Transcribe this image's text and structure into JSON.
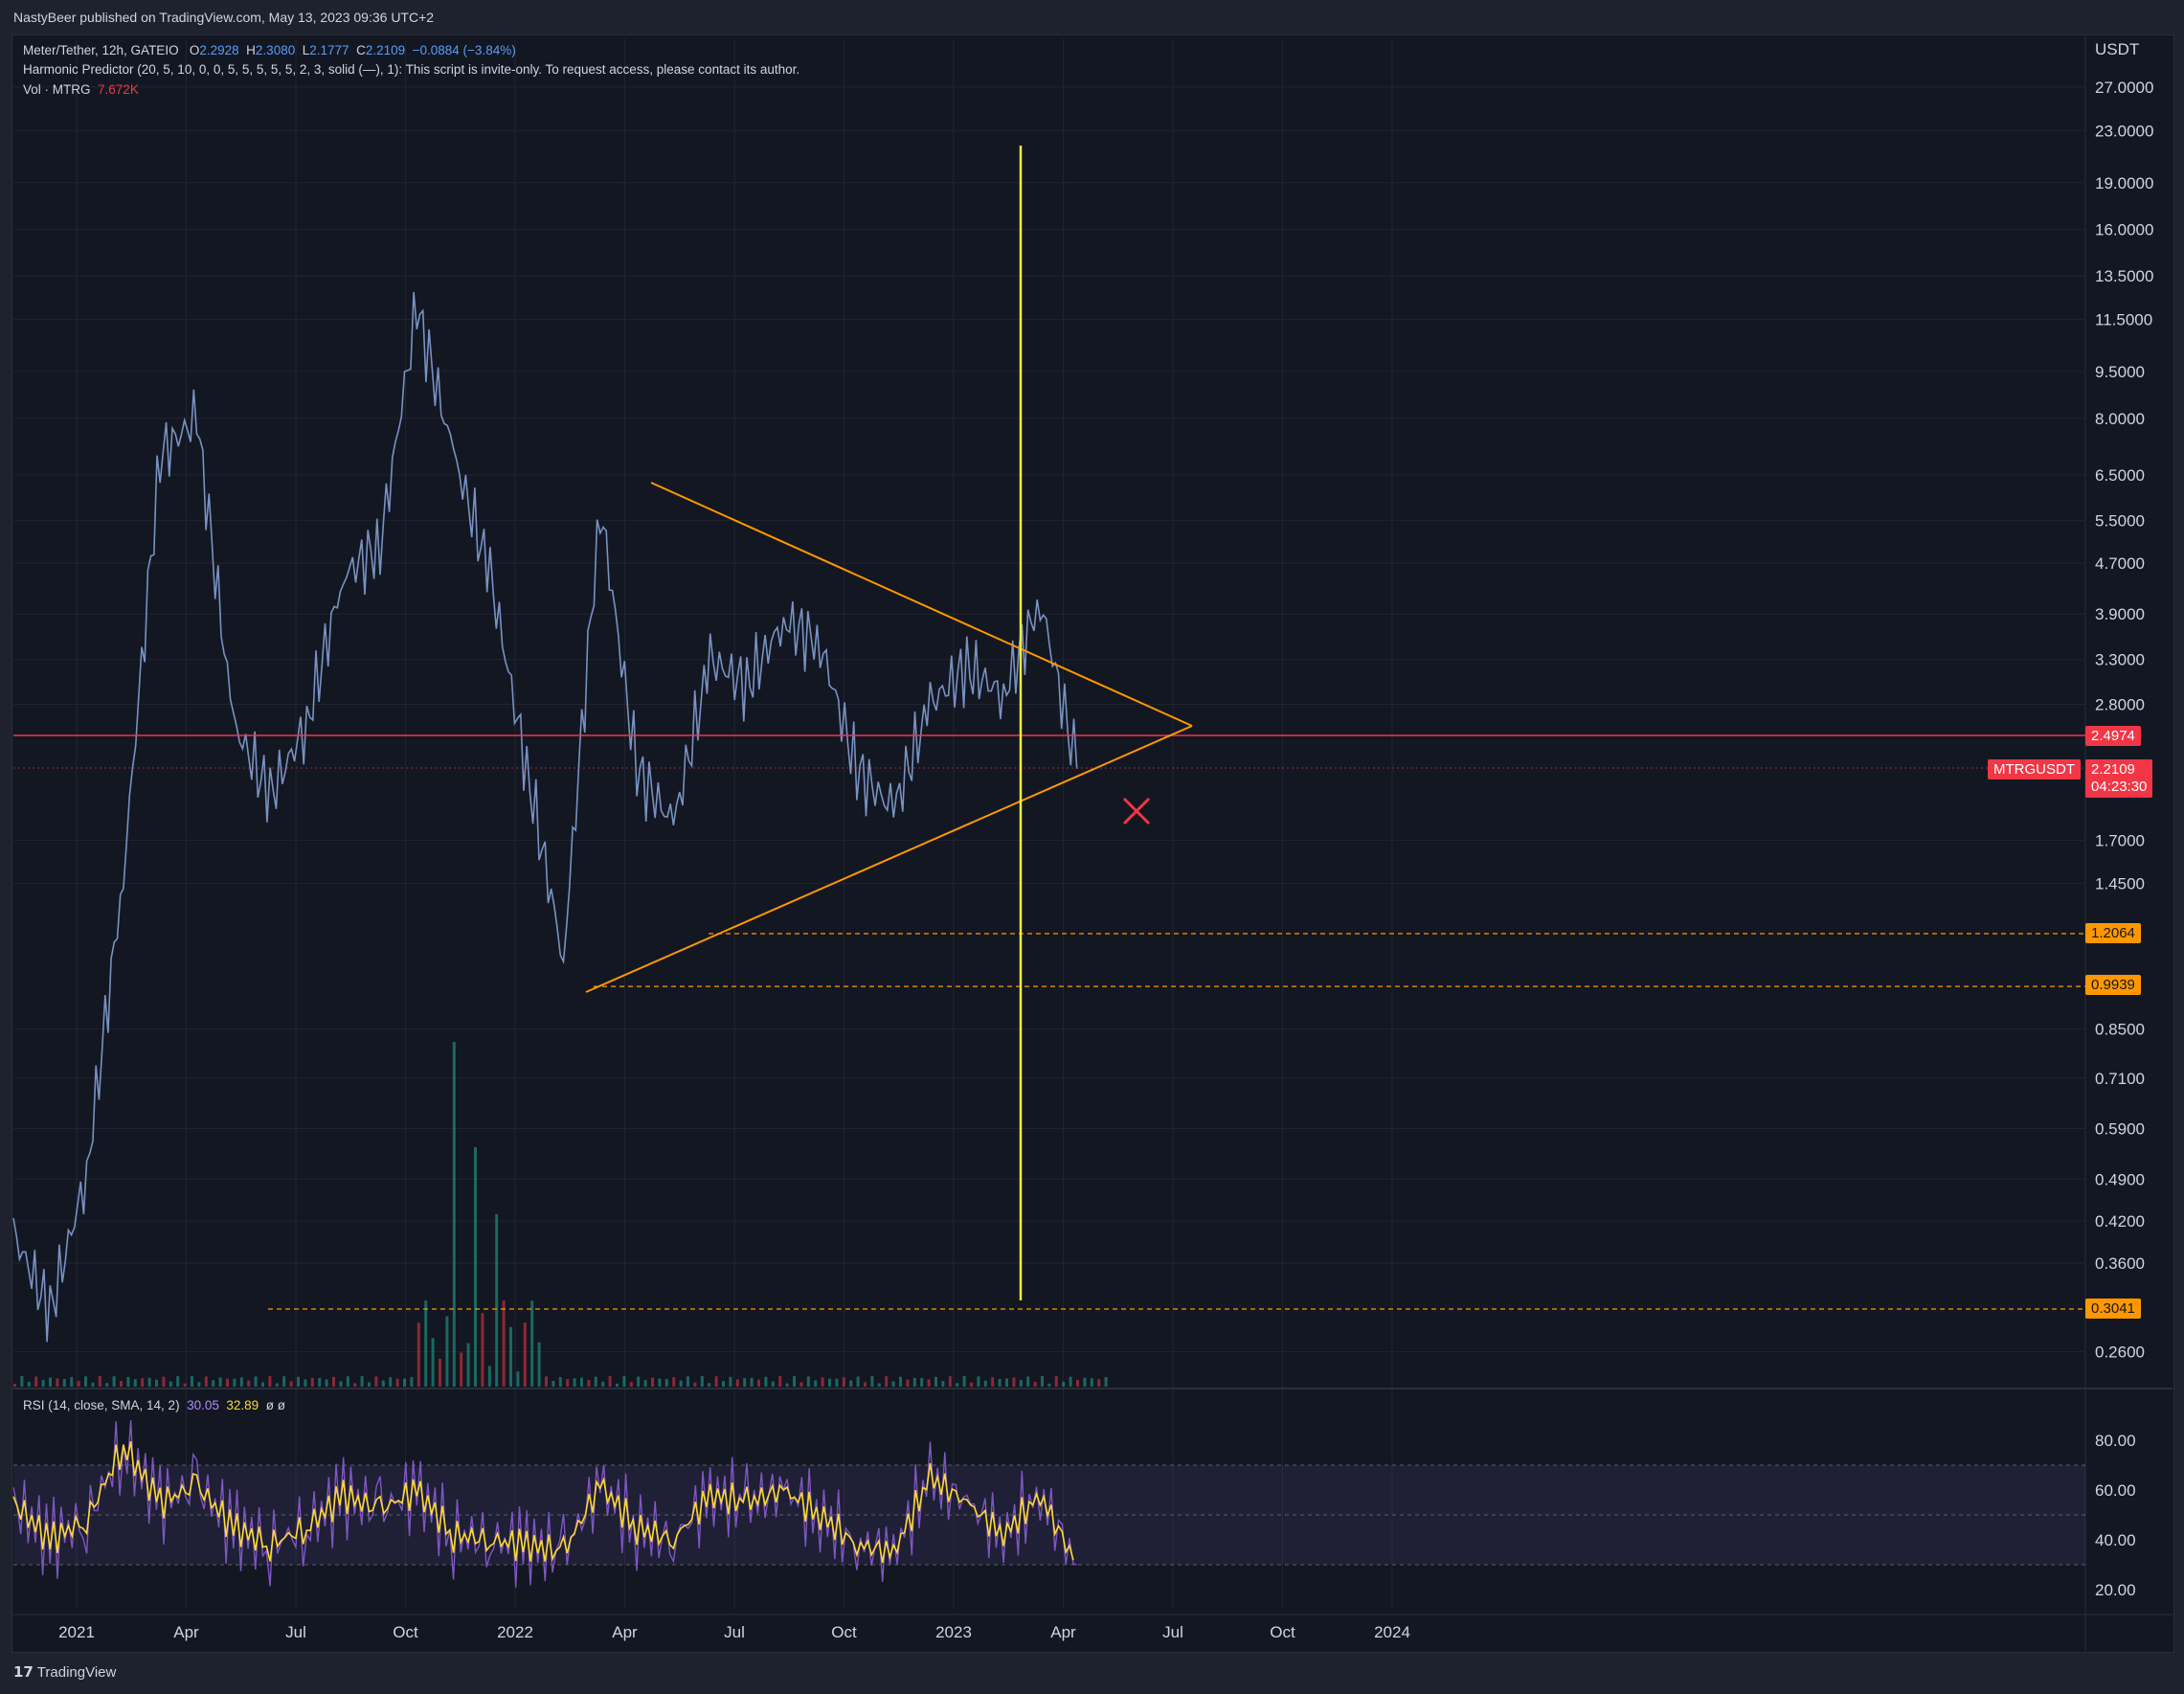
{
  "header": {
    "published": "NastyBeer published on TradingView.com, May 13, 2023 09:36 UTC+2"
  },
  "legend": {
    "symbol": "Meter/Tether, 12h, GATEIO",
    "o_label": "O",
    "o": "2.2928",
    "h_label": "H",
    "h": "2.3080",
    "l_label": "L",
    "l": "2.1777",
    "c_label": "C",
    "c": "2.2109",
    "change": "−0.0884 (−3.84%)",
    "indicator": "Harmonic Predictor (20, 5, 10, 0, 0, 5, 5, 5, 5, 5, 2, 3, solid (—), 1): This script is invite-only. To request access, please contact its author.",
    "vol_label": "Vol · MTRG",
    "vol_value": "7.672K",
    "rsi_label": "RSI (14, close, SMA, 14, 2)",
    "rsi_value": "30.05",
    "rsi_ma": "32.89",
    "rsi_extra": "ø  ø"
  },
  "price_axis": {
    "currency": "USDT",
    "labels": [
      "27.0000",
      "23.0000",
      "19.0000",
      "16.0000",
      "13.5000",
      "11.5000",
      "9.5000",
      "8.0000",
      "6.5000",
      "5.5000",
      "4.7000",
      "3.9000",
      "3.3000",
      "2.8000",
      "1.7000",
      "1.4500",
      "0.8500",
      "0.7100",
      "0.5900",
      "0.4900",
      "0.4200",
      "0.3600",
      "0.2600"
    ]
  },
  "rsi_axis": {
    "labels": [
      "80.00",
      "60.00",
      "40.00",
      "20.00"
    ]
  },
  "time_axis": {
    "labels": [
      "2021",
      "Apr",
      "Jul",
      "Oct",
      "2022",
      "Apr",
      "Jul",
      "Oct",
      "2023",
      "Apr",
      "Jul",
      "Oct",
      "2024"
    ]
  },
  "badges": {
    "resistance": "2.4974",
    "ticker": "MTRGUSDT",
    "last": "2.2109",
    "countdown": "04:23:30",
    "level1": "1.2064",
    "level2": "0.9939",
    "level3": "0.3041"
  },
  "colors": {
    "background": "#131722",
    "price_line": "#7892c2",
    "triangle": "#ff9800",
    "resistance": "#f23645",
    "vertical_line": "#ffeb3b",
    "rsi": "#7e57c2",
    "rsi_ma": "#fdd835",
    "marker": "#f23645"
  },
  "footer": {
    "brand": "TradingView"
  },
  "chart_data": [
    {
      "type": "line",
      "yscale": "log",
      "x": [
        "2020-12",
        "2021-01",
        "2021-02",
        "2021-03",
        "2021-04",
        "2021-05",
        "2021-06",
        "2021-07",
        "2021-08",
        "2021-09",
        "2021-10",
        "2021-11",
        "2021-12",
        "2022-01",
        "2022-02",
        "2022-03",
        "2022-04",
        "2022-05",
        "2022-06",
        "2022-07",
        "2022-08",
        "2022-09",
        "2022-10",
        "2022-11",
        "2022-12",
        "2023-01",
        "2023-02",
        "2023-03",
        "2023-04",
        "2023-05"
      ],
      "series": [
        {
          "values": [
            0.4,
            0.3,
            0.5,
            1.5,
            7.0,
            8.0,
            2.6,
            2.0,
            2.6,
            4.5,
            5.0,
            12.0,
            7.0,
            4.5,
            2.2,
            1.1,
            5.8,
            2.2,
            1.8,
            3.3,
            3.0,
            3.8,
            3.5,
            2.2,
            1.9,
            2.8,
            3.2,
            2.9,
            4.1,
            2.21
          ]
        }
      ],
      "lines": {
        "triangle_upper": [
          [
            "2022-04",
            "6.3"
          ],
          [
            "2023-06",
            "2.6"
          ]
        ],
        "triangle_lower": [
          [
            "2022-03",
            "0.95"
          ],
          [
            "2023-06",
            "2.6"
          ]
        ],
        "resistance": 2.4974,
        "levels": [
          1.2064,
          0.9939,
          0.3041
        ],
        "vertical": "2023-03"
      }
    },
    {
      "type": "line",
      "name": "RSI",
      "ylim": [
        10,
        90
      ],
      "levels": [
        70,
        50,
        30
      ],
      "x": [
        "2020-12",
        "2021-01",
        "2021-02",
        "2021-03",
        "2021-04",
        "2021-05",
        "2021-06",
        "2021-07",
        "2021-08",
        "2021-09",
        "2021-10",
        "2021-11",
        "2021-12",
        "2022-01",
        "2022-02",
        "2022-03",
        "2022-04",
        "2022-05",
        "2022-06",
        "2022-07",
        "2022-08",
        "2022-09",
        "2022-10",
        "2022-11",
        "2022-12",
        "2023-01",
        "2023-02",
        "2023-03",
        "2023-04",
        "2023-05"
      ],
      "series": [
        {
          "values": [
            55,
            40,
            48,
            78,
            55,
            62,
            45,
            38,
            45,
            58,
            52,
            60,
            42,
            40,
            38,
            35,
            62,
            45,
            40,
            58,
            55,
            60,
            50,
            38,
            35,
            65,
            55,
            42,
            58,
            30
          ]
        }
      ]
    }
  ]
}
